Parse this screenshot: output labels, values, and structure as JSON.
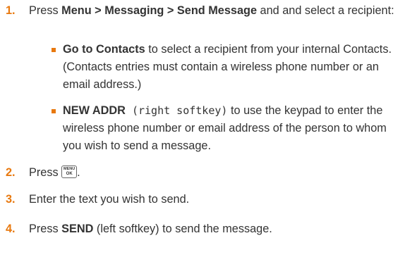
{
  "steps": [
    {
      "number": "1.",
      "pre": "Press ",
      "bold": "Menu > Messaging > Send Message",
      "post": " and and select a recipient:",
      "bullets": [
        {
          "bold": "Go to Contacts",
          "text": " to select a recipient from your internal Contacts. (Contacts entries must contain a wireless phone number or an email address.)"
        },
        {
          "bold": "NEW ADDR",
          "mono": " (right softkey)",
          "text": " to use the keypad to enter the wireless phone number or email address of the person to whom you wish to send a message."
        }
      ]
    },
    {
      "number": "2.",
      "pre": "Press ",
      "key_top": "MENU",
      "key_bottom": "OK",
      "post": "."
    },
    {
      "number": "3.",
      "text": "Enter the text you wish to send."
    },
    {
      "number": "4.",
      "pre": "Press ",
      "bold": "SEND",
      "post": " (left softkey) to send the message."
    }
  ],
  "colors": {
    "accent": "#e8790f",
    "text": "#333333"
  },
  "icons": {
    "bullet": "orange-square-bullet",
    "key": "menu-ok-key-icon"
  }
}
